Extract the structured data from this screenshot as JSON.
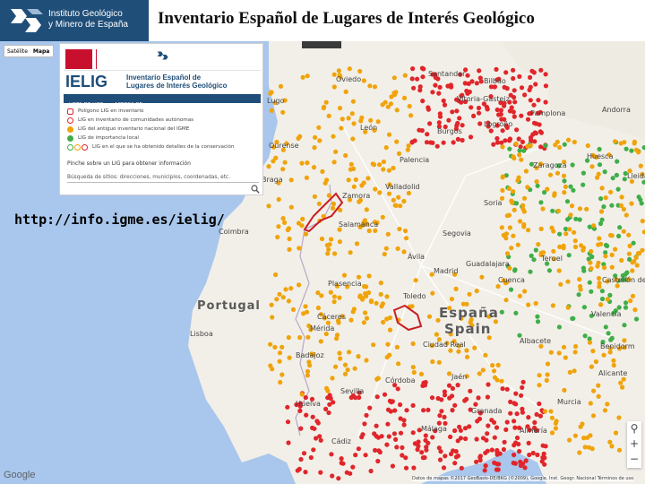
{
  "header": {
    "logo_line1": "Instituto Geológico",
    "logo_line2": "y Minero de España",
    "title": "Inventario Español de Lugares de Interés Geológico"
  },
  "url": "http://info.igme.es/ielig/",
  "map_controls": {
    "satellite": "Satélite",
    "map": "Mapa"
  },
  "panel": {
    "ielig": "IELIG",
    "subtitle_line1": "Inventario Español de",
    "subtitle_line2": "Lugares de Interés Geológico",
    "tabs": [
      "LISTA DE LIGS",
      "ACERCA DE"
    ],
    "legend": [
      {
        "text": "Polígono LIG en inventario",
        "color": "#e0262b",
        "style": "outline"
      },
      {
        "text": "LIG en inventario de comunidades autónomas",
        "color": "#e0262b",
        "style": "ring"
      },
      {
        "text": "LIG del antiguo inventario nacional del IGME",
        "color": "#f0a30a",
        "style": "fill"
      },
      {
        "text": "LIG de importancia local",
        "color": "#3fae49",
        "style": "fill"
      },
      {
        "text": "LIG en el que se ha obtenido detalles de la conservación",
        "color": "#e0262b",
        "style": "multi"
      }
    ],
    "hint": "Pinche sobre un LIG para obtener información",
    "search_placeholder": "Búsqueda de sitios: direcciones, municipios, coordenadas, etc."
  },
  "map": {
    "country_labels": [
      {
        "text": "Portugal"
      },
      {
        "text": "España"
      },
      {
        "text": "Spain"
      }
    ],
    "city_labels": [
      "Oviedo",
      "Santander",
      "Bilbao",
      "Lugo",
      "Ourense",
      "León",
      "Burgos",
      "Pamplona",
      "Huesca",
      "Lleida",
      "Valladolid",
      "Zaragoza",
      "Zamora",
      "Salamanca",
      "Ávila",
      "Segovia",
      "Soria",
      "Teruel",
      "Plasencia",
      "Madrid",
      "Toledo",
      "Cuenca",
      "Cáceres",
      "Castellón de la Plana",
      "Valencia",
      "Lisboa",
      "Badajoz",
      "Ciudad Real",
      "Albacete",
      "Córdoba",
      "Jaén",
      "Murcia",
      "Alicante",
      "Benidorm",
      "Almería",
      "Granada",
      "Huelva",
      "Sevilla",
      "Málaga",
      "Cádiz",
      "Coimbra",
      "Braga",
      "Logroño",
      "Vitoria-Gasteiz",
      "Palencia",
      "Guadalajara",
      "Mérida",
      "Andorra"
    ],
    "google": "Google",
    "attribution": "Datos de mapas ©2017 GeoBasis-DE/BKG (©2009), Google, Inst. Geogr. Nacional   Términos de uso"
  },
  "colors": {
    "sea": "#a9c6ec",
    "land": "#f2efe8",
    "dot_red": "#e0262b",
    "dot_orange": "#f0a30a",
    "dot_green": "#3fae49",
    "header_blue": "#1f4e79"
  }
}
